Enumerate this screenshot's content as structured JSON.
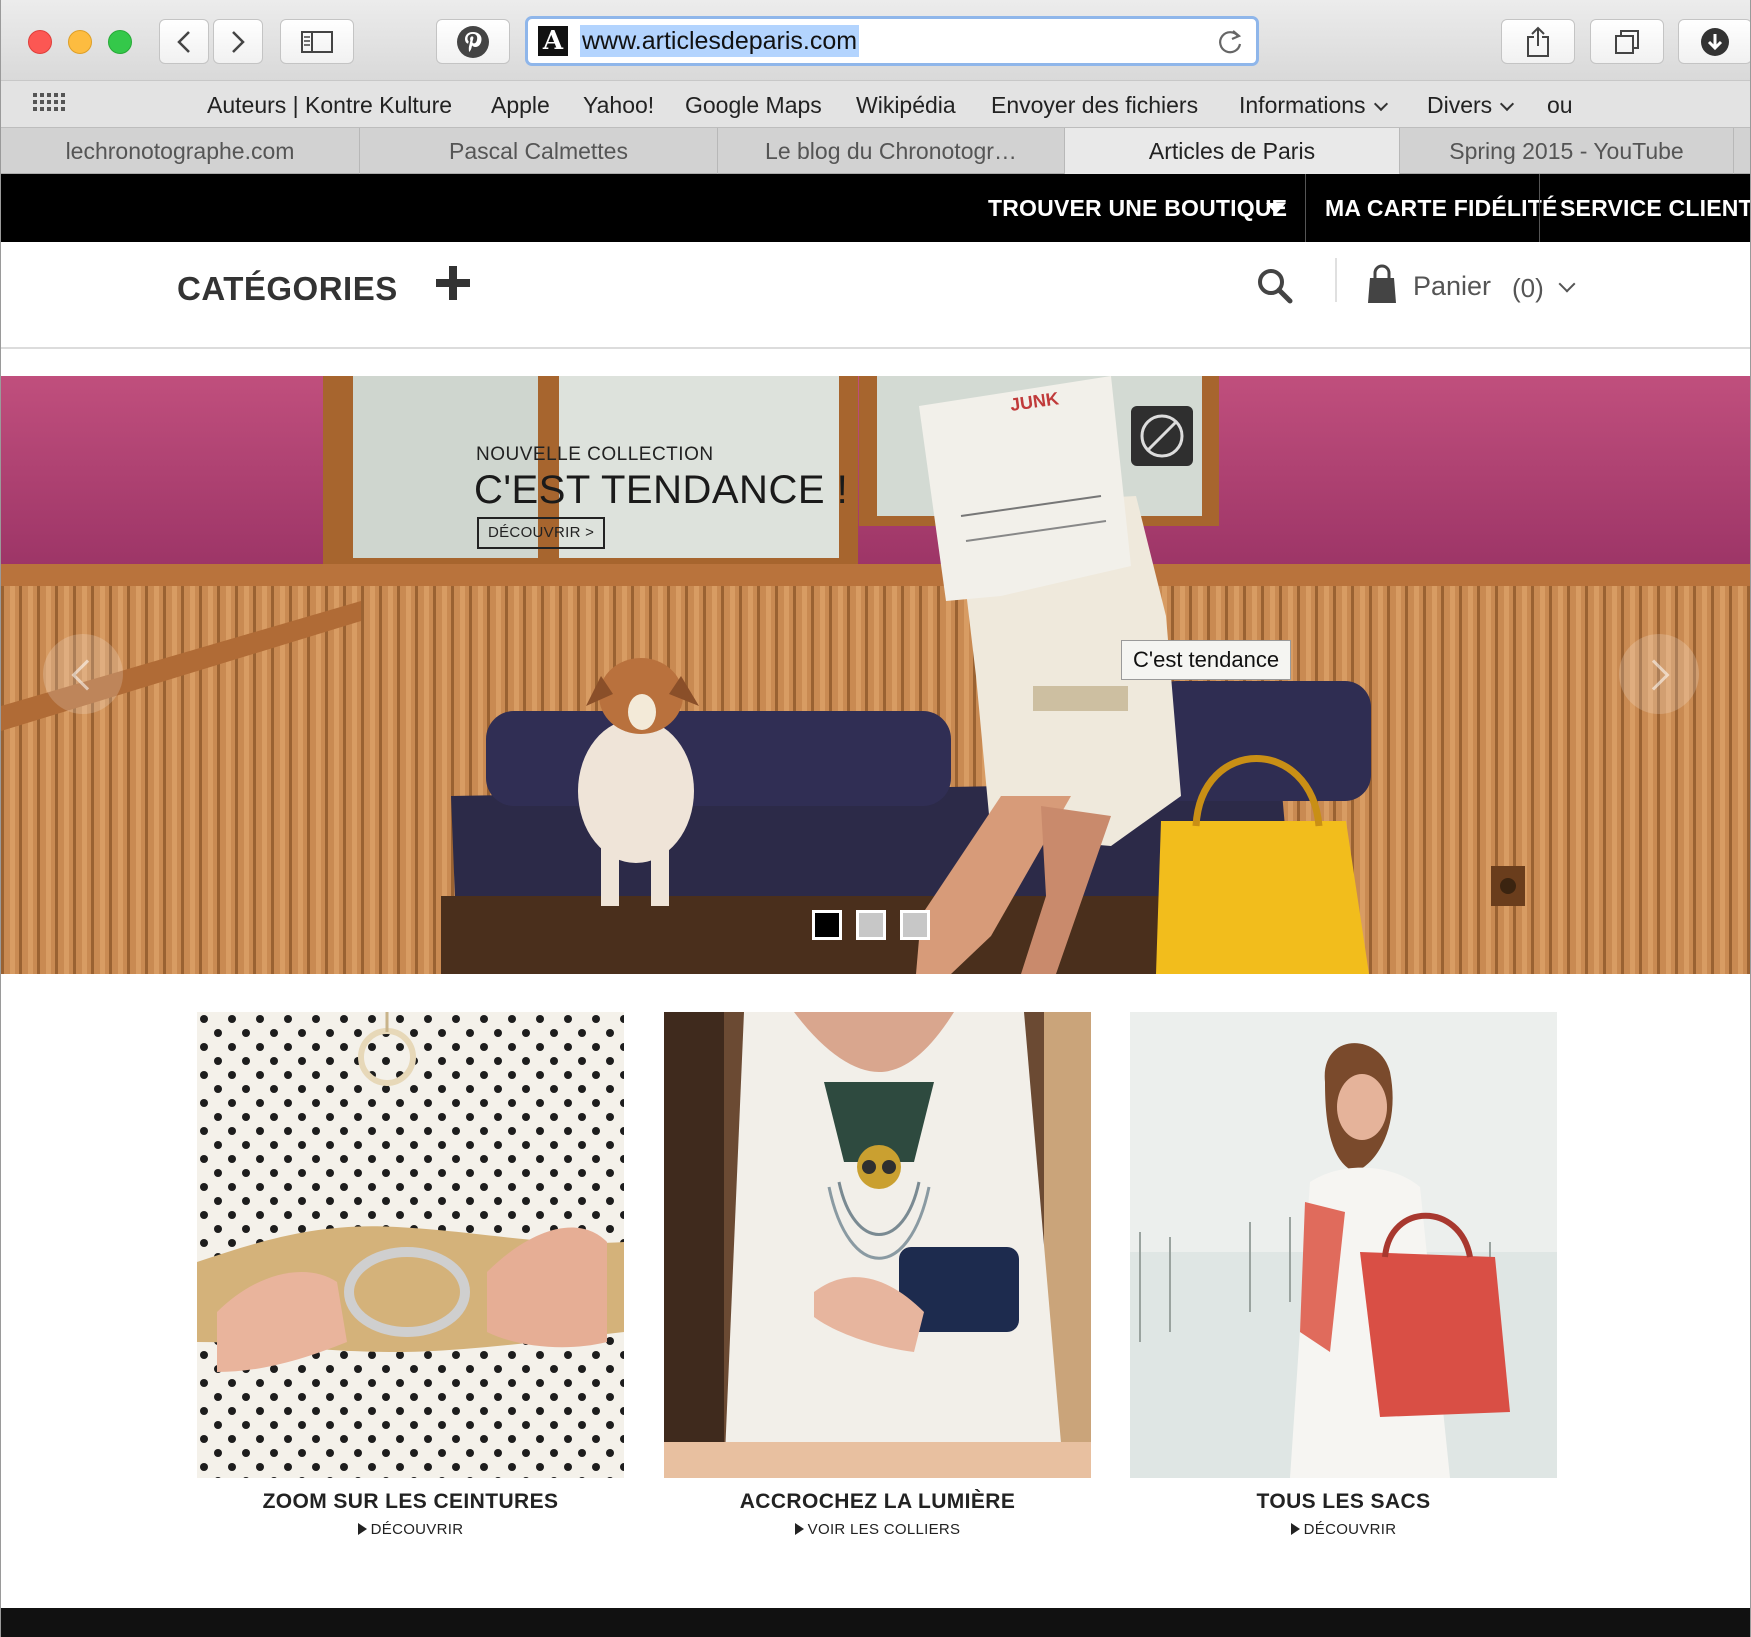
{
  "browser": {
    "url": "www.articlesdeparis.com",
    "favorites": [
      {
        "label": "Auteurs | Kontre Kulture",
        "menu": false
      },
      {
        "label": "Apple",
        "menu": false
      },
      {
        "label": "Yahoo!",
        "menu": false
      },
      {
        "label": "Google Maps",
        "menu": false
      },
      {
        "label": "Wikipédia",
        "menu": false
      },
      {
        "label": "Envoyer des fichiers",
        "menu": false
      },
      {
        "label": "Informations",
        "menu": true
      },
      {
        "label": "Divers",
        "menu": true
      },
      {
        "label": "ou",
        "menu": false
      }
    ],
    "tabs": [
      {
        "label": "lechronotographe.com",
        "active": false
      },
      {
        "label": "Pascal Calmettes",
        "active": false
      },
      {
        "label": "Le blog du Chronotogr…",
        "active": false
      },
      {
        "label": "Articles de Paris",
        "active": true
      },
      {
        "label": "Spring 2015 - YouTube",
        "active": false
      }
    ],
    "icons": {
      "site_favicon": "A",
      "pinterest": "pinterest-icon",
      "share": "share-icon",
      "tabs_overview": "tabs-icon",
      "downloads": "download-icon"
    },
    "accent": "#8fb6ea"
  },
  "site": {
    "topnav": {
      "store_finder": "TROUVER UNE BOUTIQUE",
      "loyalty": "MA CARTE FIDÉLITÉ",
      "service": "SERVICE CLIENTS"
    },
    "categories_label": "CATÉGORIES",
    "cart": {
      "label": "Panier",
      "count": "(0)"
    },
    "hero": {
      "kicker": "NOUVELLE COLLECTION",
      "title": "C'EST TENDANCE !",
      "button": "DÉCOUVRIR >",
      "tooltip": "C'est tendance",
      "slides": 3,
      "active_slide": 1
    },
    "tiles": [
      {
        "title": "ZOOM SUR LES CEINTURES",
        "link": "DÉCOUVRIR"
      },
      {
        "title": "ACCROCHEZ LA LUMIÈRE",
        "link": "VOIR LES COLLIERS"
      },
      {
        "title": "TOUS LES SACS",
        "link": "DÉCOUVRIR"
      }
    ]
  }
}
